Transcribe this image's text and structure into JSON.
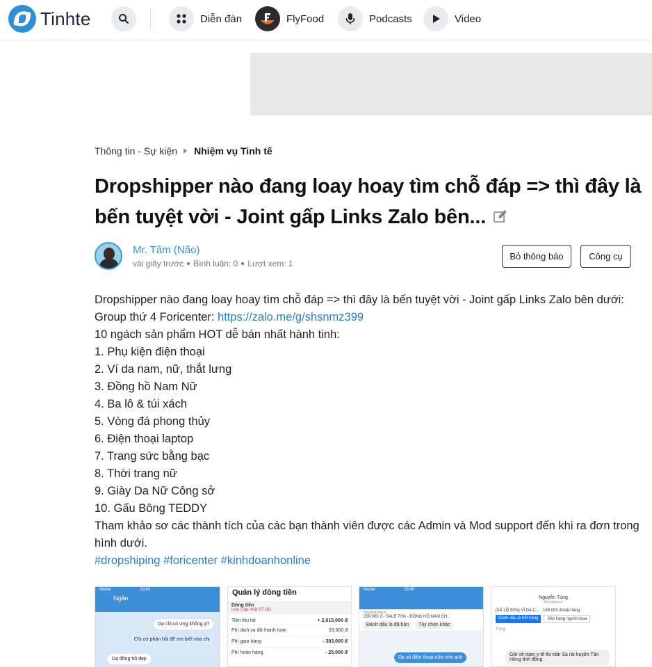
{
  "brand": {
    "name": "Tinhte",
    "accent": "#2d8fd8"
  },
  "nav": {
    "items": [
      {
        "label": "Diễn đàn",
        "icon": "grid-dots-icon"
      },
      {
        "label": "FlyFood",
        "icon": "flyfood-logo-icon"
      },
      {
        "label": "Podcasts",
        "icon": "microphone-icon"
      },
      {
        "label": "Video",
        "icon": "play-icon"
      }
    ]
  },
  "breadcrumb": {
    "parent": "Thông tin - Sự kiện",
    "current": "Nhiệm vụ Tinh tế"
  },
  "thread": {
    "title": "Dropshipper nào đang loay hoay tìm chỗ đáp => thì đây là bến tuyệt vời - Joint gấp Links Zalo bên...",
    "author": "Mr. Tâm (Não)",
    "time": "vài giây trước",
    "comments": "Bình luận: 0",
    "views": "Lượt xem: 1",
    "unfollow_label": "Bỏ thông báo",
    "tools_label": "Công cụ"
  },
  "content": {
    "line1": "Dropshipper nào đang loay hoay tìm chỗ đáp => thì đây là bến tuyệt vời - Joint gấp Links Zalo bên dưới:",
    "group_prefix": "Group thứ 4 Foricenter: ",
    "group_link": "https://zalo.me/g/shsnmz399",
    "intro": "10 ngách sản phẩm HOT dễ bán nhất hành tinh:",
    "list": [
      "1. Phụ kiện điện thoại",
      "2. Ví da nam, nữ, thắt lưng",
      "3. Đồng hồ Nam Nữ",
      "4. Ba lô & túi xách",
      "5. Vòng đá phong thủy",
      "6. Điện thoại laptop",
      "7. Trang sức bằng bạc",
      "8. Thời trang nữ",
      "9. Giày Da Nữ Công sở",
      "10. Gấu Bông TEDDY"
    ],
    "outro": "Tham khảo sơ các thành tích của các bạn thành viên được các Admin và Mod support đến khi ra đơn trong hình dưới.",
    "tags": [
      "#dropshiping",
      "#foricenter",
      "#kinhdoanhonline"
    ]
  },
  "thumbs": {
    "t1": {
      "status": "Viettel",
      "time": "18:43",
      "name": "Ngân",
      "msg1": "Dạ chị có ưng không ạ?",
      "msg2": "Chị cứ phản hồi để em biết nha chị",
      "msg3": "Dạ đồng hồ đẹp"
    },
    "t2": {
      "title": "Quản lý dòng tiền",
      "subtitle": "Dòng tiền",
      "live": "Live (cập nhật 07:18)",
      "rows": [
        {
          "label": "Tiền thu hộ",
          "value": "+ 2,615,000 đ"
        },
        {
          "label": "Phí dịch vụ đã thanh toán",
          "value": "33,000 đ"
        },
        {
          "label": "Phí giao hàng",
          "value": "- 383,000 đ"
        },
        {
          "label": "Phí hoàn hàng",
          "value": "- 25,000 đ"
        }
      ]
    },
    "t3": {
      "status": "Viettel",
      "time": "18:45",
      "market": "Marketplace",
      "price": "259.000 đ - SALE 70% - ĐỒNG HỒ NAM CH...",
      "btn1": "Đánh dấu là đã bán",
      "btn2": "Tùy chọn khác",
      "msg": "Dạ số điện thoại nữa nha anh"
    },
    "t4": {
      "name": "Nguyễn Tùng",
      "market": "Marketplace",
      "product": "[XẢ LỖ 50%] VÍ DA C... · 199.000 đ/mặt hàng",
      "btn1": "Đánh dấu là hết hàng",
      "btn2": "Xếp hạng người mua",
      "sender": "Tùng",
      "msg": "Gởi về trạm y tế thị trấn Sa rài huyện Tân Hồng tỉnh đồng"
    }
  }
}
